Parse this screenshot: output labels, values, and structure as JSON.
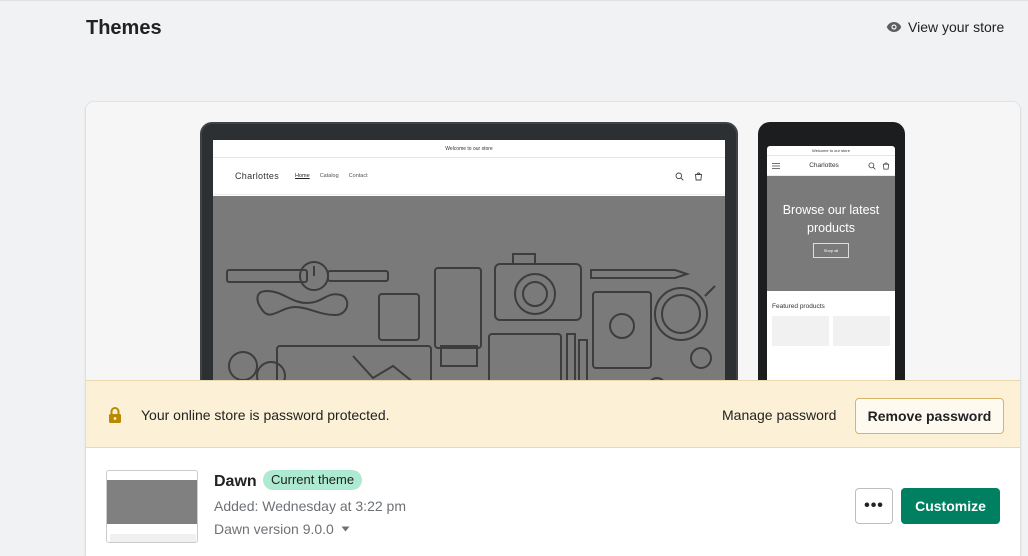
{
  "page": {
    "title": "Themes",
    "view_store_label": "View your store"
  },
  "preview": {
    "desktop": {
      "announcement": "Welcome to our store",
      "store_name": "Charlottes",
      "nav": [
        "Home",
        "Catalog",
        "Contact"
      ]
    },
    "mobile": {
      "announcement": "Welcome to our store",
      "store_name": "Charlottes",
      "hero_title": "Browse our latest products",
      "hero_button": "Shop all",
      "featured_label": "Featured products"
    }
  },
  "banner": {
    "message": "Your online store is password protected.",
    "manage_label": "Manage password",
    "remove_label": "Remove password"
  },
  "theme": {
    "name": "Dawn",
    "badge": "Current theme",
    "added": "Added: Wednesday at 3:22 pm",
    "version": "Dawn version 9.0.0",
    "more_label": "•••",
    "customize_label": "Customize"
  },
  "colors": {
    "primary": "#008060",
    "badge_bg": "#aee9d1",
    "banner_bg": "#fcf1d6",
    "lock_icon": "#b98900"
  },
  "icons": [
    "eye-icon",
    "lock-icon",
    "search-icon",
    "cart-icon",
    "menu-icon",
    "caret-down-icon",
    "more-horizontal-icon"
  ]
}
